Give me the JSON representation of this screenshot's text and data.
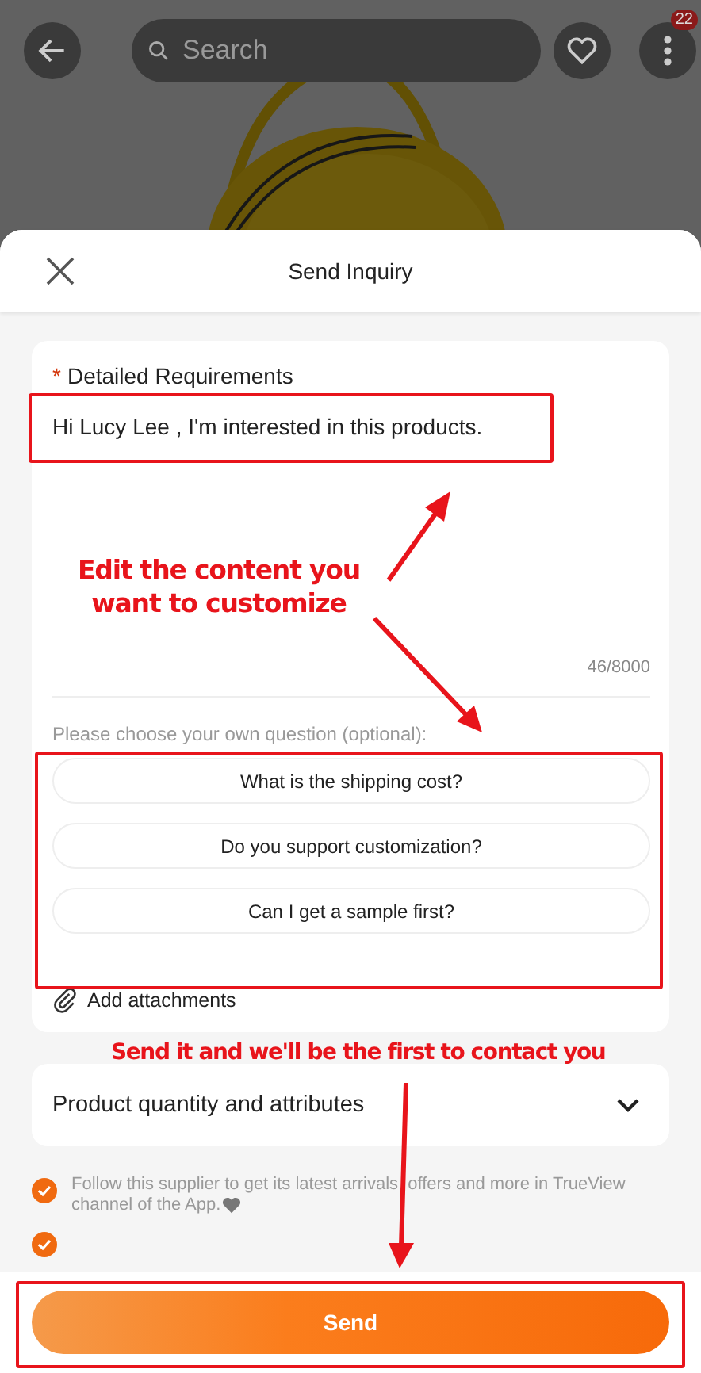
{
  "top_bar": {
    "search": {
      "placeholder": "Search"
    },
    "badge": "22"
  },
  "sheet": {
    "title": "Send Inquiry"
  },
  "requirements": {
    "label": "Detailed Requirements",
    "required_mark": "*",
    "value": "Hi Lucy Lee , I'm interested in this products.",
    "counter": "46/8000"
  },
  "questions": {
    "hint": "Please choose your own question (optional):",
    "options": [
      {
        "label": "What is the shipping cost?",
        "selected": false
      },
      {
        "label": "Do you support customization?",
        "selected": false
      },
      {
        "label": "Can I get a sample first?",
        "selected": false
      }
    ]
  },
  "attachments": {
    "label": "Add attachments"
  },
  "product_section": {
    "title": "Product quantity and attributes",
    "expanded": false
  },
  "consents": [
    {
      "label": "Follow this supplier to get its latest arrivals, offers and more in TrueView channel of the App.",
      "checked": true
    },
    {
      "checked": true
    }
  ],
  "send_button": "Send",
  "annotations": [
    {
      "text": "Edit the content you want to customize"
    },
    {
      "text": "Send it and we'll be the first to contact you"
    }
  ]
}
